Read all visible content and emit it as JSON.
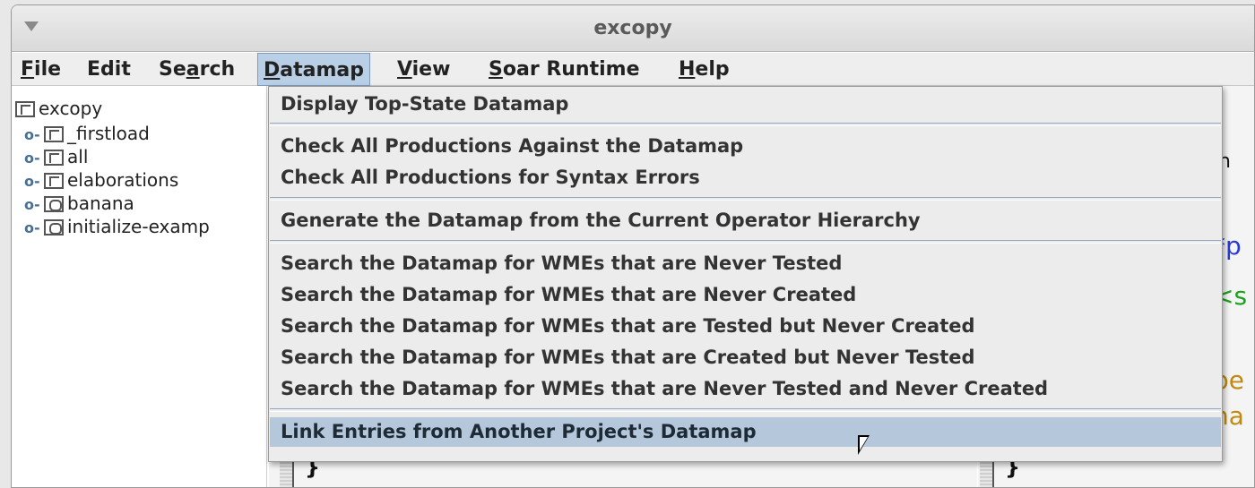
{
  "window": {
    "title": "excopy"
  },
  "menubar": {
    "items": [
      {
        "pre": "",
        "key": "F",
        "post": "ile"
      },
      {
        "pre": "Edit",
        "key": "",
        "post": ""
      },
      {
        "pre": "Se",
        "key": "a",
        "post": "rch"
      },
      {
        "pre": "",
        "key": "D",
        "post": "atamap"
      },
      {
        "pre": "",
        "key": "V",
        "post": "iew"
      },
      {
        "pre": "",
        "key": "S",
        "post": "oar Runtime"
      },
      {
        "pre": "",
        "key": "H",
        "post": "elp"
      }
    ]
  },
  "tree": {
    "root": "excopy",
    "children": [
      {
        "label": "_firstload",
        "icon": "folder-file-icon"
      },
      {
        "label": "all",
        "icon": "folder-file-icon"
      },
      {
        "label": "elaborations",
        "icon": "folder-file-icon"
      },
      {
        "label": "banana",
        "icon": "operator-icon"
      },
      {
        "label": "initialize-examp",
        "icon": "operator-icon"
      }
    ]
  },
  "datamap_menu": {
    "items": [
      "Display Top-State Datamap",
      "Check All Productions Against the Datamap",
      "Check All Productions for Syntax Errors",
      "Generate the Datamap from the Current Operator Hierarchy",
      "Search the Datamap for WMEs that are Never Tested",
      "Search the Datamap for WMEs that are Never Created",
      "Search the Datamap for WMEs that are Tested but Never Created",
      "Search the Datamap for WMEs that are Created but Never Tested",
      "Search the Datamap for WMEs that are Never Tested and Never Created",
      "Link Entries from Another Project's  Datamap"
    ],
    "hovered_index": 9
  },
  "editor_b": {
    "fragments": [
      "n",
      "*p",
      "<s",
      "pe",
      "na"
    ]
  },
  "colors": {
    "menu_highlight": "#b8cfe5",
    "item_hover": "#b4c7db",
    "code_blue": "#2a38d6",
    "code_green": "#1aa31a",
    "code_gold": "#c08a10"
  }
}
